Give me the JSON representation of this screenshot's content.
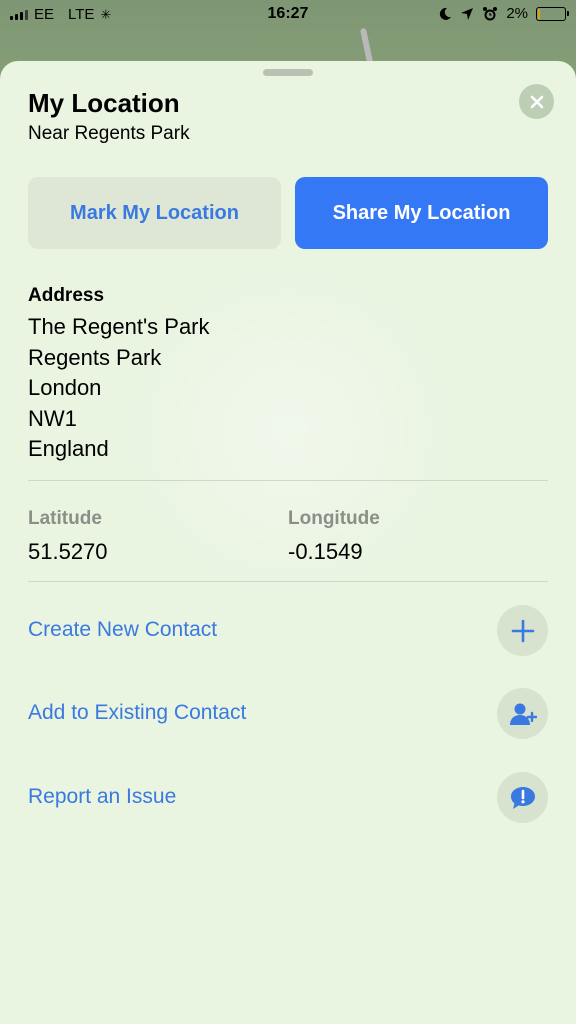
{
  "status_bar": {
    "carrier": "EE",
    "network": "LTE",
    "time": "16:27",
    "battery": "2%"
  },
  "sheet": {
    "title": "My Location",
    "subtitle": "Near Regents Park",
    "mark_button": "Mark My Location",
    "share_button": "Share My Location",
    "address_label": "Address",
    "address_lines": [
      "The Regent's Park",
      "Regents Park",
      "London",
      "NW1",
      "England"
    ],
    "latitude_label": "Latitude",
    "latitude_value": "51.5270",
    "longitude_label": "Longitude",
    "longitude_value": "-0.1549",
    "actions": [
      {
        "label": "Create New Contact",
        "icon": "plus-icon"
      },
      {
        "label": "Add to Existing Contact",
        "icon": "add-person-icon"
      },
      {
        "label": "Report an Issue",
        "icon": "report-bubble-icon"
      }
    ]
  },
  "colors": {
    "accent": "#3478f6",
    "link": "#3a7ae0",
    "sheet_bg": "#e9f4e1"
  }
}
